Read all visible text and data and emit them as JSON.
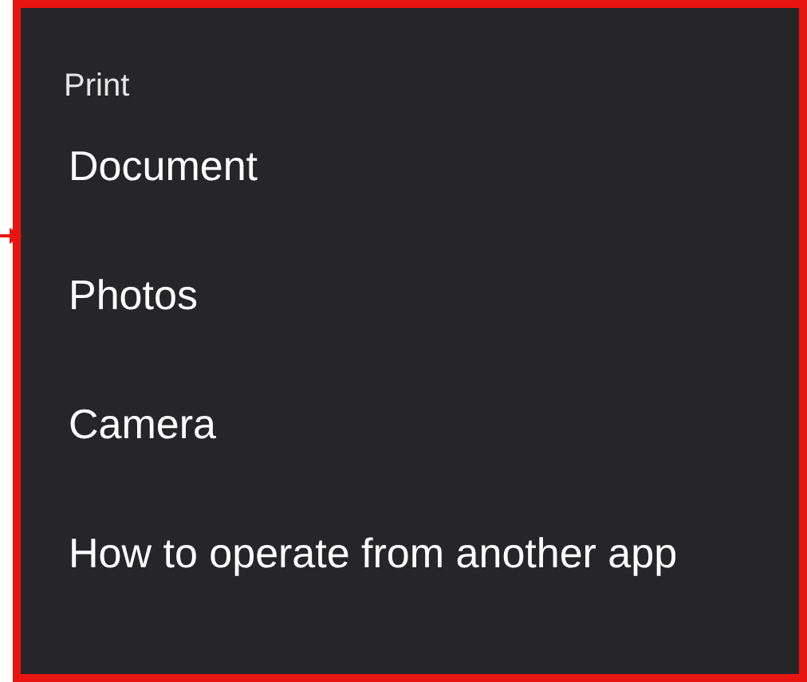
{
  "menu": {
    "title": "Print",
    "items": [
      {
        "label": "Document"
      },
      {
        "label": "Photos"
      },
      {
        "label": "Camera"
      },
      {
        "label": "How to operate from another app"
      }
    ]
  }
}
